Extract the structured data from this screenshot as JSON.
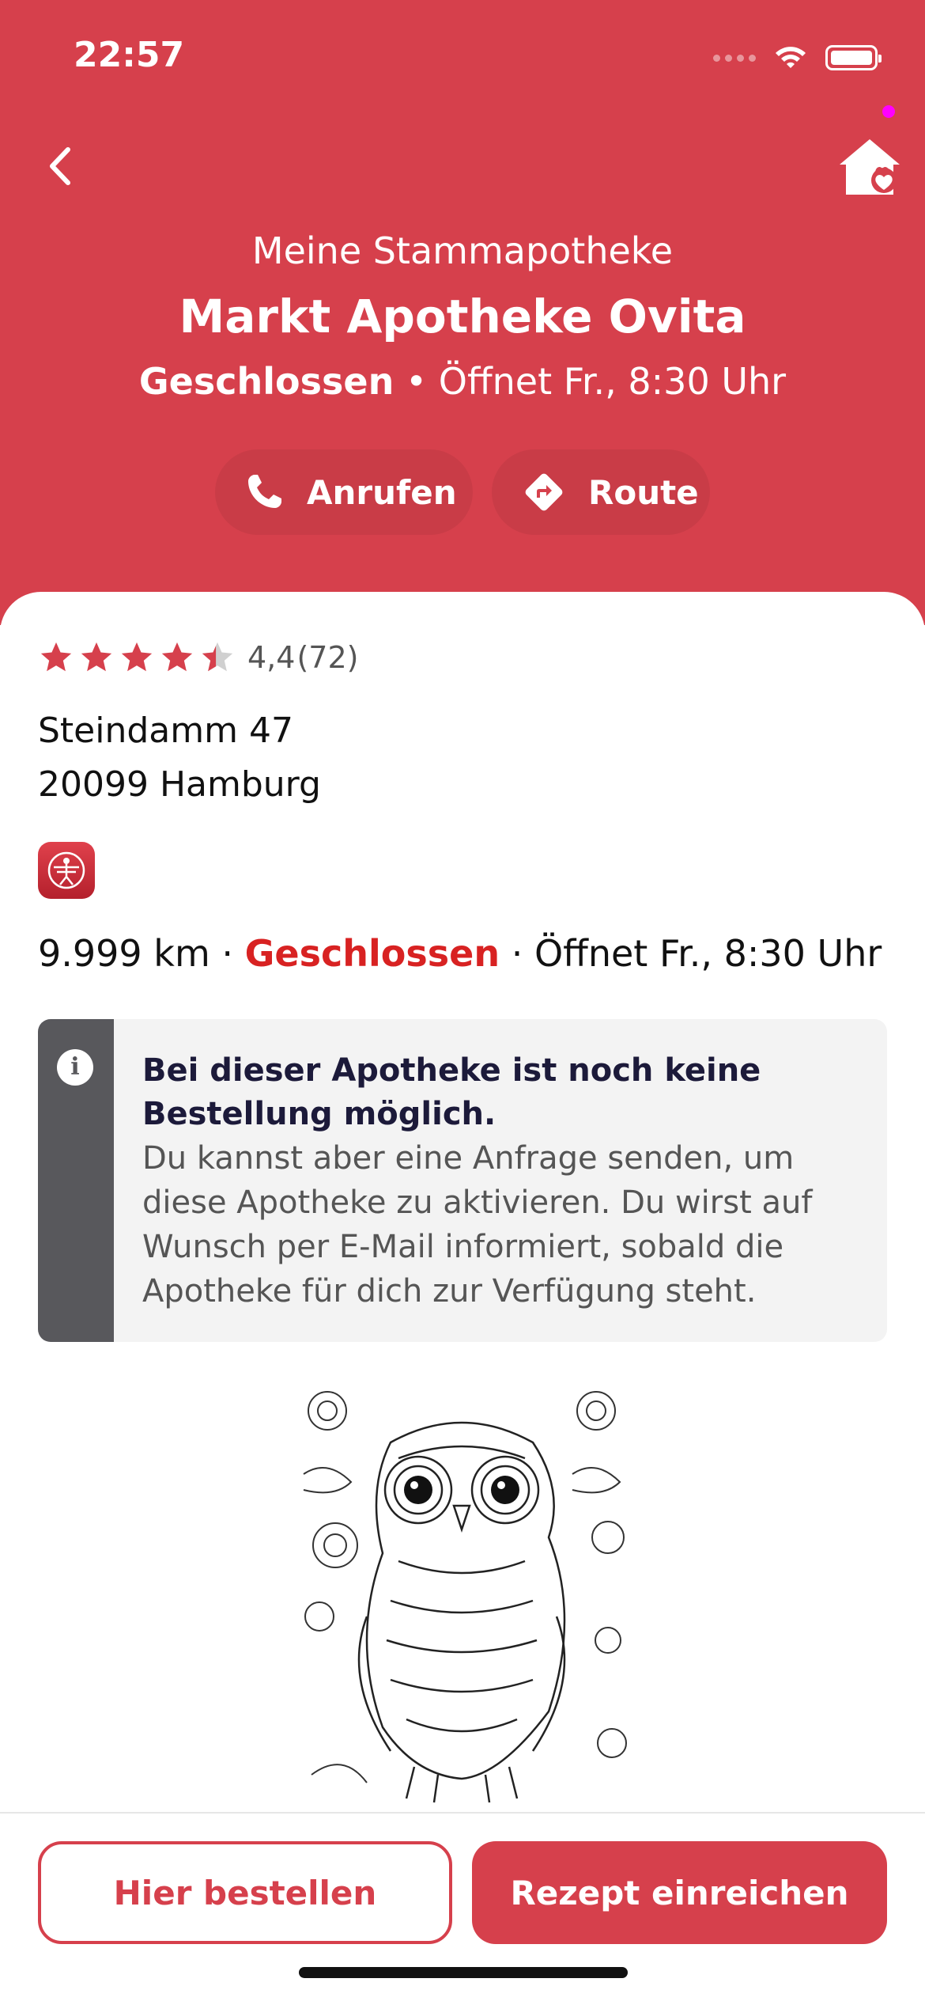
{
  "status_bar": {
    "time": "22:57"
  },
  "header": {
    "caption": "Meine Stammapotheke",
    "title": "Markt Apotheke Ovita",
    "status": "Geschlossen",
    "separator": " • ",
    "opens": "Öffnet Fr., 8:30 Uhr",
    "call_label": "Anrufen",
    "route_label": "Route"
  },
  "details": {
    "rating_value": 4.4,
    "rating_text": "4,4",
    "rating_count": "(72)",
    "address_street": "Steindamm 47",
    "address_city": "20099 Hamburg",
    "distance": "9.999 km",
    "dot1": " · ",
    "status": "Geschlossen",
    "dot2": " · ",
    "opens": "Öffnet Fr., 8:30 Uhr"
  },
  "info": {
    "icon": "i",
    "title": "Bei dieser Apotheke ist noch keine Bestellung möglich.",
    "body": "Du kannst aber eine Anfrage senden, um diese Apotheke zu aktivieren. Du wirst auf Wunsch per E-Mail informiert, sobald die Apotheke für dich zur Verfügung steht."
  },
  "actions": {
    "order_label": "Hier bestellen",
    "prescription_label": "Rezept einreichen"
  },
  "colors": {
    "brand": "#d6404c",
    "closed": "#d82222",
    "info_strip": "#58585c"
  },
  "icons": [
    "chevron-left-icon",
    "home-heart-icon",
    "phone-icon",
    "route-icon",
    "star-icon",
    "info-icon",
    "pharmacy-app-icon"
  ]
}
